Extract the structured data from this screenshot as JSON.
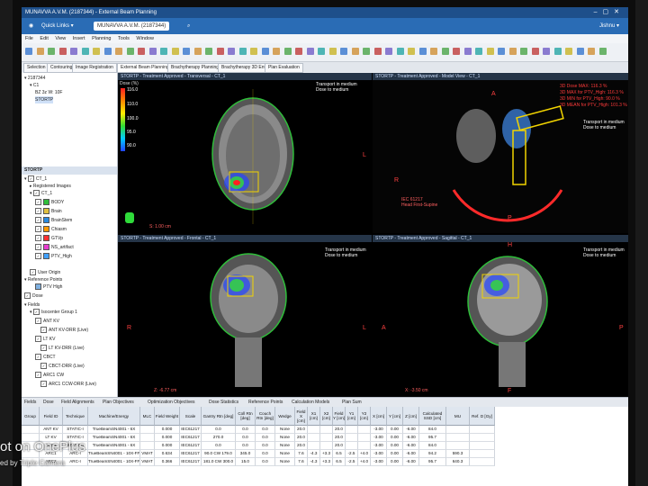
{
  "window": {
    "title": "MUNAVVA A.V.M. (2187344) - External Beam Planning"
  },
  "quickbar": {
    "app_label": "Quick Links ▾",
    "patient": "MUNAVVA A.V.M. (2187344)",
    "user": "Jishnu ▾"
  },
  "menu": [
    "File",
    "Edit",
    "View",
    "Insert",
    "Planning",
    "Tools",
    "Window"
  ],
  "workspace_tabs": [
    "Selection",
    "Contouring",
    "Image Registration",
    "External Beam Planning",
    "Brachytherapy Planning",
    "Brachytherapy 3D Entry",
    "Plan Evaluation"
  ],
  "active_tab": "External Beam Planning",
  "tree": {
    "patient_id": "2187344",
    "items": [
      "C1",
      "BZ 3z W: 10F",
      "STORTP"
    ],
    "struct_header": "STORTP",
    "ct": "CT_1",
    "reg_images": "Registered Images",
    "ct2": "CT_1",
    "structures": [
      {
        "name": "BODY",
        "color": "#2fbd3a"
      },
      {
        "name": "Brain",
        "color": "#e0c040"
      },
      {
        "name": "BrainStem",
        "color": "#2a8adf"
      },
      {
        "name": "Chiasm",
        "color": "#ff9900"
      },
      {
        "name": "GTVp",
        "color": "#ff3030"
      },
      {
        "name": "NS_artifact",
        "color": "#e83ccf"
      },
      {
        "name": "PTV_High",
        "color": "#40a0ff"
      }
    ],
    "user_origin": "User Origin",
    "ref_points": "Reference Points",
    "ptv_high": "PTV High",
    "dose": "Dose",
    "fields": "Fields",
    "isocenter": "Isocenter Group 1",
    "field_items": [
      "ANT KV",
      "ANT KV-DRR (Live)",
      "LT KV",
      "LT KV-DRR (Live)",
      "CBCT",
      "CBCT-DRR (Live)",
      "ARC1 CW",
      "ARC1 CCW-DRR (Live)"
    ]
  },
  "views": {
    "transversal": {
      "header": "STORTP - Treatment Approved - Transversal - CT_1",
      "dose_label": "Dose (%)",
      "legend": [
        "116.0",
        "110.0",
        "100.0",
        "95.0",
        "90.0"
      ],
      "transport": "Transport in medium\nDose to medium",
      "scale": "S: 1.00 cm",
      "right_label": "L"
    },
    "model": {
      "header": "STORTP - Treatment Approved - Model View - CT_1",
      "stats": [
        "3D Dose MAX: 116.3 %",
        "3D MAX for PTV_High: 116.3 %",
        "3D MIN for PTV_High: 90.0 %",
        "3D MEAN for PTV_High: 101.3 %"
      ],
      "transport": "Transport in medium\nDose to medium",
      "ic": "IEC 61217\nHead First-Supine",
      "labels": {
        "a": "A",
        "p": "P",
        "r": "R"
      }
    },
    "frontal": {
      "header": "STORTP - Treatment Approved - Frontal - CT_1",
      "transport": "Transport in medium\nDose to medium",
      "scale": "Z: -6.77 cm",
      "labels": {
        "r": "R",
        "l": "L",
        "h": "H"
      }
    },
    "sagittal": {
      "header": "STORTP - Treatment Approved - Sagittal - CT_1",
      "transport": "Transport in medium\nDose to medium",
      "scale": "X: -3.50 cm",
      "labels": {
        "h": "H",
        "a": "A",
        "p": "P",
        "f": "F"
      }
    }
  },
  "bottom_tabs": [
    "Fields",
    "Dose",
    "Field Alignments",
    "Plan Objectives",
    "Optimization Objectives",
    "Dose Statistics",
    "Reference Points",
    "Calculation Models",
    "Plan Sum"
  ],
  "table": {
    "columns": [
      "Group",
      "Field ID",
      "Technique",
      "Machine/Energy",
      "MLC",
      "Field Weight",
      "Scale",
      "Gantry Rtn [deg]",
      "Coll Rtn [deg]",
      "Couch Rtn [deg]",
      "Wedge",
      "Field X [cm]",
      "X1 [cm]",
      "X2 [cm]",
      "Field Y [cm]",
      "Y1 [cm]",
      "Y2 [cm]",
      "X [cm]",
      "Y [cm]",
      "Z [cm]",
      "Calculated SSD [cm]",
      "MU",
      "Ref. D [Gy]"
    ],
    "rows": [
      [
        "",
        "ANT KV",
        "STATIC-I",
        "TrueBeamSN4001 - 6X",
        "",
        "0.000",
        "IEC61217",
        "0.0",
        "0.0",
        "0.0",
        "None",
        "20.0",
        "",
        "",
        "20.0",
        "",
        "",
        "-3.00",
        "0.00",
        "-6.00",
        "84.0",
        "",
        ""
      ],
      [
        "",
        "LT KV",
        "STATIC-I",
        "TrueBeamSN4001 - 6X",
        "",
        "0.000",
        "IEC61217",
        "270.0",
        "0.0",
        "0.0",
        "None",
        "20.0",
        "",
        "",
        "20.0",
        "",
        "",
        "-3.00",
        "0.00",
        "-6.00",
        "95.7",
        "",
        ""
      ],
      [
        "",
        "CBCT",
        "STATIC-I",
        "TrueBeamSN4001 - 6X",
        "",
        "0.000",
        "IEC61217",
        "0.0",
        "0.0",
        "0.0",
        "None",
        "20.0",
        "",
        "",
        "20.0",
        "",
        "",
        "-3.00",
        "0.00",
        "-6.00",
        "84.0",
        "",
        ""
      ],
      [
        "",
        "ARC1",
        "ARC-I",
        "TrueBeamSN4001 - 10X-FFF",
        "VMAT",
        "0.634",
        "IEC61217",
        "90.0 CW 179.0",
        "345.0",
        "0.0",
        "None",
        "7.6",
        "-4.3",
        "+3.3",
        "6.5",
        "-2.5",
        "+4.0",
        "-3.00",
        "0.00",
        "-6.00",
        "94.2",
        "590.3",
        ""
      ],
      [
        "",
        "ARC2",
        "ARC-I",
        "TrueBeamSN4001 - 10X-FFF",
        "VMAT",
        "0.366",
        "IEC61217",
        "181.0 CW 300.0",
        "15.0",
        "0.0",
        "None",
        "7.6",
        "-4.3",
        "+3.3",
        "6.5",
        "-2.5",
        "+4.0",
        "-3.00",
        "0.00",
        "-6.00",
        "95.7",
        "640.3",
        ""
      ]
    ]
  },
  "watermark": {
    "line1": "ot on OnePlus",
    "line2": "ed by Triple Camera"
  }
}
